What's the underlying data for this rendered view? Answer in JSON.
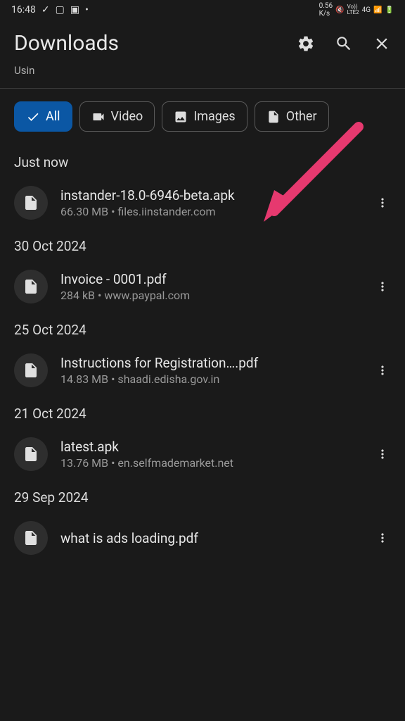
{
  "status": {
    "time": "16:48",
    "net_speed": "0.56",
    "net_unit": "K/s",
    "net_type": "4G",
    "lte": "LTE2"
  },
  "header": {
    "title": "Downloads",
    "subtext": "Usin"
  },
  "filters": {
    "all": "All",
    "video": "Video",
    "images": "Images",
    "other": "Other"
  },
  "sections": [
    {
      "label": "Just now",
      "files": [
        {
          "name": "instander-18.0-6946-beta.apk",
          "size": "66.30 MB",
          "source": "files.iinstander.com"
        }
      ]
    },
    {
      "label": "30 Oct 2024",
      "files": [
        {
          "name": "Invoice - 0001.pdf",
          "size": "284 kB",
          "source": "www.paypal.com"
        }
      ]
    },
    {
      "label": "25 Oct 2024",
      "files": [
        {
          "name": "Instructions for Registration….pdf",
          "size": "14.83 MB",
          "source": "shaadi.edisha.gov.in"
        }
      ]
    },
    {
      "label": "21 Oct 2024",
      "files": [
        {
          "name": "latest.apk",
          "size": "13.76 MB",
          "source": "en.selfmademarket.net"
        }
      ]
    },
    {
      "label": "29 Sep 2024",
      "files": [
        {
          "name": "what is ads loading.pdf",
          "size": "",
          "source": ""
        }
      ]
    }
  ]
}
